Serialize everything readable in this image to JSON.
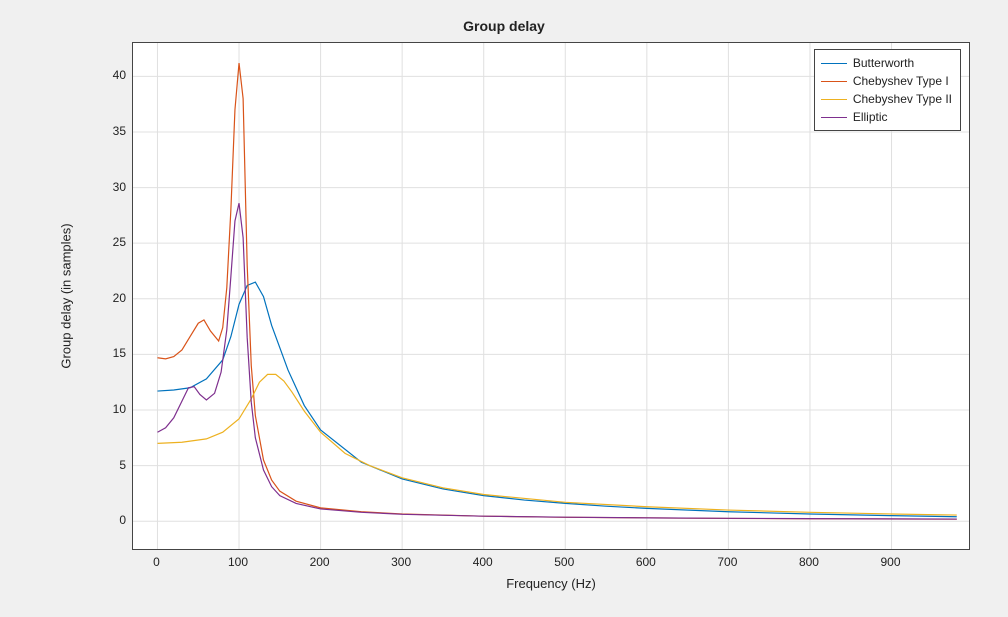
{
  "chart_data": {
    "type": "line",
    "title": "Group delay",
    "xlabel": "Frequency (Hz)",
    "ylabel": "Group delay (in samples)",
    "xlim": [
      -30,
      995
    ],
    "ylim": [
      -2.5,
      43
    ],
    "xticks": [
      0,
      100,
      200,
      300,
      400,
      500,
      600,
      700,
      800,
      900
    ],
    "yticks": [
      0,
      5,
      10,
      15,
      20,
      25,
      30,
      35,
      40
    ],
    "series": [
      {
        "name": "Butterworth",
        "color": "#0072bd",
        "x": [
          0,
          20,
          40,
          60,
          80,
          90,
          100,
          110,
          120,
          130,
          140,
          160,
          180,
          200,
          250,
          300,
          350,
          400,
          450,
          500,
          550,
          600,
          700,
          800,
          900,
          980
        ],
        "y": [
          11.7,
          11.8,
          12.0,
          12.8,
          14.5,
          16.6,
          19.5,
          21.2,
          21.5,
          20.2,
          17.6,
          13.6,
          10.4,
          8.2,
          5.3,
          3.8,
          2.9,
          2.3,
          1.9,
          1.6,
          1.35,
          1.15,
          0.85,
          0.65,
          0.5,
          0.4
        ]
      },
      {
        "name": "Chebyshev Type I",
        "color": "#d95319",
        "x": [
          0,
          10,
          20,
          30,
          40,
          50,
          57,
          65,
          75,
          80,
          85,
          90,
          95,
          100,
          105,
          110,
          115,
          120,
          130,
          140,
          150,
          170,
          200,
          250,
          300,
          400,
          500,
          600,
          700,
          800,
          900,
          980
        ],
        "y": [
          14.7,
          14.6,
          14.8,
          15.4,
          16.6,
          17.8,
          18.1,
          17.1,
          16.2,
          17.4,
          21.0,
          28.0,
          37.0,
          41.2,
          38.0,
          23.0,
          14.0,
          9.5,
          5.5,
          3.7,
          2.7,
          1.8,
          1.2,
          0.85,
          0.65,
          0.45,
          0.35,
          0.3,
          0.25,
          0.22,
          0.2,
          0.18
        ]
      },
      {
        "name": "Chebyshev Type II",
        "color": "#edb120",
        "x": [
          0,
          30,
          60,
          80,
          100,
          115,
          125,
          135,
          145,
          155,
          165,
          180,
          200,
          230,
          260,
          300,
          350,
          400,
          500,
          600,
          700,
          800,
          900,
          980
        ],
        "y": [
          7.0,
          7.1,
          7.4,
          8.0,
          9.2,
          11.0,
          12.5,
          13.2,
          13.2,
          12.6,
          11.6,
          9.9,
          8.0,
          6.1,
          5.0,
          3.9,
          3.0,
          2.4,
          1.7,
          1.3,
          1.0,
          0.8,
          0.65,
          0.55
        ]
      },
      {
        "name": "Elliptic",
        "color": "#7e2f8e",
        "x": [
          0,
          10,
          20,
          30,
          38,
          45,
          52,
          60,
          70,
          78,
          85,
          90,
          95,
          100,
          105,
          110,
          115,
          120,
          130,
          140,
          150,
          170,
          200,
          250,
          300,
          400,
          500,
          600,
          700,
          800,
          900,
          980
        ],
        "y": [
          8.0,
          8.4,
          9.3,
          10.8,
          12.0,
          12.1,
          11.4,
          10.9,
          11.5,
          13.4,
          17.2,
          22.0,
          27.0,
          28.6,
          25.5,
          16.5,
          10.7,
          7.5,
          4.6,
          3.1,
          2.3,
          1.6,
          1.1,
          0.8,
          0.62,
          0.45,
          0.36,
          0.3,
          0.26,
          0.23,
          0.21,
          0.19
        ]
      }
    ],
    "legend_position": "upper right"
  }
}
